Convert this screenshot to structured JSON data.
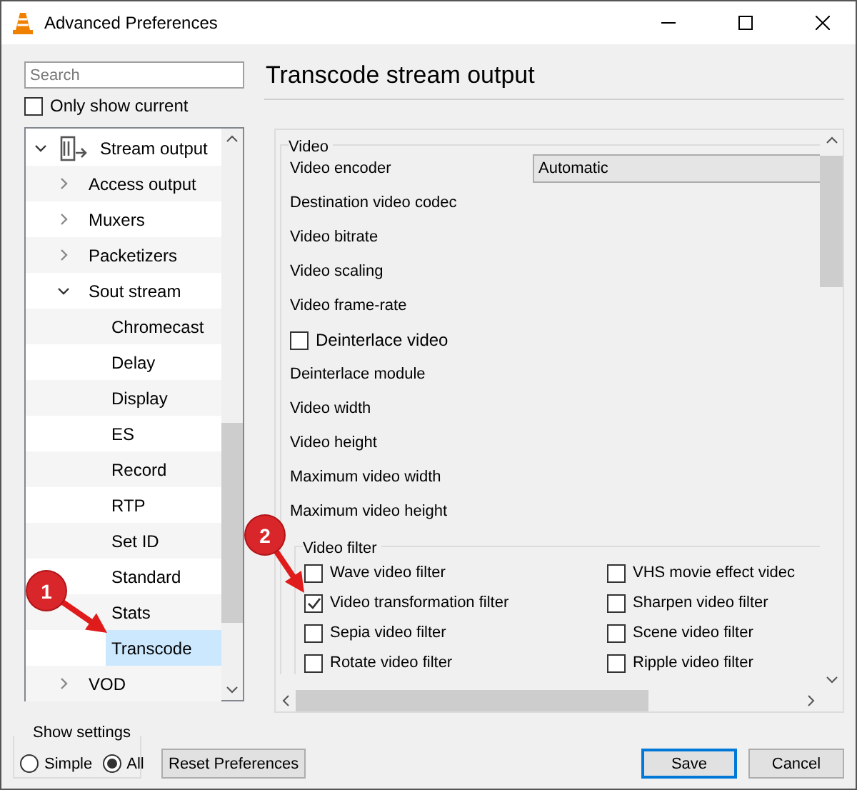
{
  "window": {
    "title": "Advanced Preferences"
  },
  "search": {
    "placeholder": "Search"
  },
  "only_show_current": {
    "label": "Only show current",
    "checked": false
  },
  "tree": {
    "items": [
      {
        "label": "Stream output",
        "expanded": true,
        "selected": false,
        "children": [
          {
            "label": "Access output",
            "expanded": false,
            "selected": false
          },
          {
            "label": "Muxers",
            "expanded": false,
            "selected": false
          },
          {
            "label": "Packetizers",
            "expanded": false,
            "selected": false
          },
          {
            "label": "Sout stream",
            "expanded": true,
            "selected": false,
            "children": [
              {
                "label": "Chromecast",
                "selected": false
              },
              {
                "label": "Delay",
                "selected": false
              },
              {
                "label": "Display",
                "selected": false
              },
              {
                "label": "ES",
                "selected": false
              },
              {
                "label": "Record",
                "selected": false
              },
              {
                "label": "RTP",
                "selected": false
              },
              {
                "label": "Set ID",
                "selected": false
              },
              {
                "label": "Standard",
                "selected": false
              },
              {
                "label": "Stats",
                "selected": false
              },
              {
                "label": "Transcode",
                "selected": true
              }
            ]
          },
          {
            "label": "VOD",
            "expanded": false,
            "selected": false
          }
        ]
      }
    ]
  },
  "show_settings": {
    "title": "Show settings",
    "options": [
      {
        "label": "Simple",
        "selected": false
      },
      {
        "label": "All",
        "selected": true
      }
    ]
  },
  "panel": {
    "title": "Transcode stream output",
    "section": {
      "title": "Video",
      "fields": [
        {
          "kind": "select",
          "label": "Video encoder",
          "value": "Automatic"
        },
        {
          "kind": "label",
          "label": "Destination video codec"
        },
        {
          "kind": "label",
          "label": "Video bitrate"
        },
        {
          "kind": "label",
          "label": "Video scaling"
        },
        {
          "kind": "label",
          "label": "Video frame-rate"
        },
        {
          "kind": "checkbox",
          "label": "Deinterlace video",
          "checked": false
        },
        {
          "kind": "label",
          "label": "Deinterlace module"
        },
        {
          "kind": "label",
          "label": "Video width"
        },
        {
          "kind": "label",
          "label": "Video height"
        },
        {
          "kind": "label",
          "label": "Maximum video width"
        },
        {
          "kind": "label",
          "label": "Maximum video height"
        }
      ],
      "filter_group": {
        "title": "Video filter",
        "filters": [
          {
            "label": "Wave video filter",
            "checked": false
          },
          {
            "label": "VHS movie effect videc",
            "checked": false
          },
          {
            "label": "Video transformation filter",
            "checked": true
          },
          {
            "label": "Sharpen video filter",
            "checked": false
          },
          {
            "label": "Sepia video filter",
            "checked": false
          },
          {
            "label": "Scene video filter",
            "checked": false
          },
          {
            "label": "Rotate video filter",
            "checked": false
          },
          {
            "label": "Ripple video filter",
            "checked": false
          }
        ]
      }
    }
  },
  "buttons": {
    "reset": "Reset Preferences",
    "save": "Save",
    "cancel": "Cancel"
  },
  "annotations": [
    {
      "label": "1"
    },
    {
      "label": "2"
    }
  ]
}
